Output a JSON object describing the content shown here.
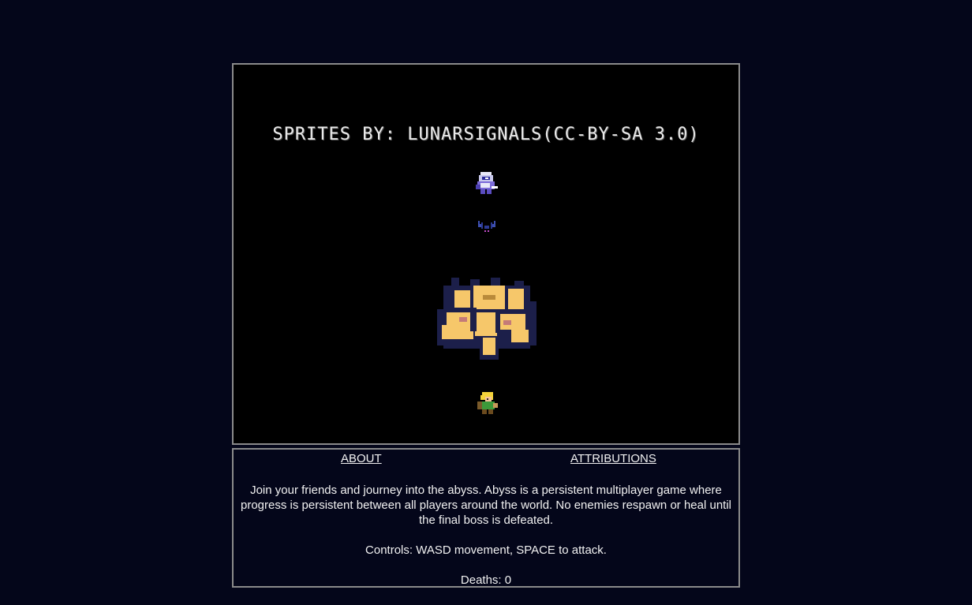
{
  "game": {
    "credit": "SPRITES BY: LUNARSIGNALS(CC-BY-SA 3.0)",
    "sprites": [
      "knight-sprite",
      "bat-sprite",
      "boss-sprite",
      "hero-sprite"
    ]
  },
  "info": {
    "tabs": {
      "about": "ABOUT",
      "attributions": "ATTRIBUTIONS"
    },
    "description": "Join your friends and journey into the abyss. Abyss is a persistent multiplayer game where progress is persistent between all players around the world. No enemies respawn or heal until the final boss is defeated.",
    "controls": "Controls: WASD movement, SPACE to attack.",
    "deaths": "Deaths: 0"
  },
  "colors": {
    "page_bg": "#04061a",
    "canvas_bg": "#000000",
    "border": "#8a8a8a",
    "boss_main": "#f6c76a",
    "boss_shadow": "#1c1f4a"
  }
}
